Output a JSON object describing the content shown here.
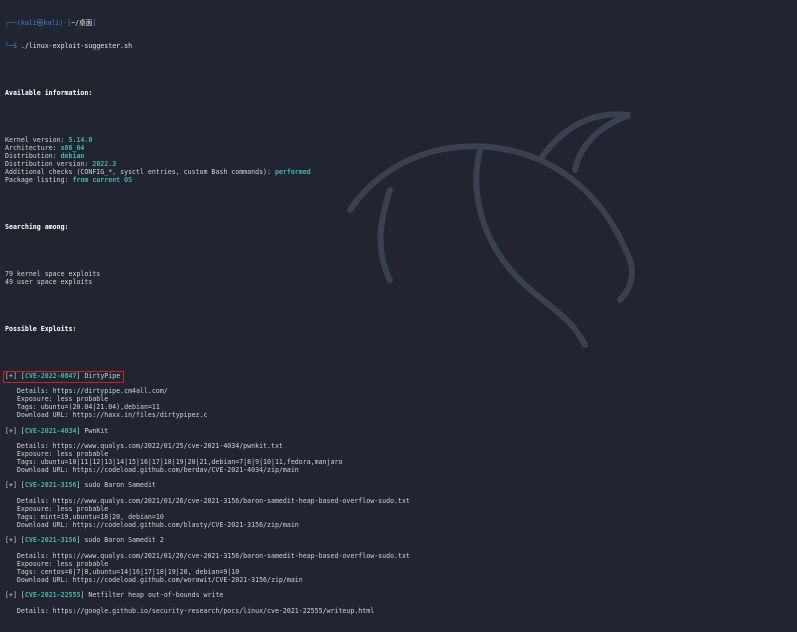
{
  "prompt": {
    "line1_prefix": "┌──(",
    "user": "kali",
    "at": "㉿",
    "host": "kali",
    "line1_mid": ")-[",
    "cwd": "~/桌面",
    "line1_end": "]",
    "line2_prefix": "└─$ ",
    "command": "./linux-exploit-suggester.sh"
  },
  "available": {
    "heading": "Available information:",
    "rows": [
      {
        "label": "Kernel version: ",
        "value": "5.14.0"
      },
      {
        "label": "Architecture: ",
        "value": "x86_64"
      },
      {
        "label": "Distribution: ",
        "value": "debian"
      },
      {
        "label": "Distribution version: ",
        "value": "2022.3"
      },
      {
        "label": "Additional checks (CONFIG_*, sysctl entries, custom Bash commands): ",
        "value": "performed"
      },
      {
        "label": "Package listing: ",
        "value": "from current OS"
      }
    ]
  },
  "searching": {
    "heading": "Searching among:",
    "lines": [
      "79 kernel space exploits",
      "49 user space exploits"
    ]
  },
  "possible": {
    "heading": "Possible Exploits:",
    "exploits": [
      {
        "tag": "[+] ",
        "lb": "[",
        "cve": "CVE-2022-0847",
        "rb": "]",
        "name": " DirtyPipe",
        "details": [
          "   Details: https://dirtypipe.cm4all.com/",
          "   Exposure: less probable",
          "   Tags: ubuntu=(20.04|21.04),debian=11",
          "   Download URL: https://haxx.in/files/dirtypipez.c"
        ]
      },
      {
        "tag": "[+] ",
        "lb": "[",
        "cve": "CVE-2021-4034",
        "rb": "]",
        "name": " PwnKit",
        "details": [
          "   Details: https://www.qualys.com/2022/01/25/cve-2021-4034/pwnkit.txt",
          "   Exposure: less probable",
          "   Tags: ubuntu=10|11|12|13|14|15|16|17|18|19|20|21,debian=7|8|9|10|11,fedora,manjaro",
          "   Download URL: https://codeload.github.com/berdav/CVE-2021-4034/zip/main"
        ]
      },
      {
        "tag": "[+] ",
        "lb": "[",
        "cve": "CVE-2021-3156",
        "rb": "]",
        "name": " sudo Baron Samedit",
        "details": [
          "   Details: https://www.qualys.com/2021/01/26/cve-2021-3156/baron-samedit-heap-based-overflow-sudo.txt",
          "   Exposure: less probable",
          "   Tags: mint=19,ubuntu=18|20, debian=10",
          "   Download URL: https://codeload.github.com/blasty/CVE-2021-3156/zip/main"
        ]
      },
      {
        "tag": "[+] ",
        "lb": "[",
        "cve": "CVE-2021-3156",
        "rb": "]",
        "name": " sudo Baron Samedit 2",
        "details": [
          "   Details: https://www.qualys.com/2021/01/26/cve-2021-3156/baron-samedit-heap-based-overflow-sudo.txt",
          "   Exposure: less probable",
          "   Tags: centos=6|7|8,ubuntu=14|16|17|18|19|20, debian=9|10",
          "   Download URL: https://codeload.github.com/worawit/CVE-2021-3156/zip/main"
        ]
      },
      {
        "tag": "[+] ",
        "lb": "[",
        "cve": "CVE-2021-22555",
        "rb": "]",
        "name": " Netfilter heap out-of-bounds write",
        "details": [
          "   Details: https://google.github.io/security-research/pocs/linux/cve-2021-22555/writeup.html"
        ]
      }
    ]
  },
  "colors": {
    "background": "#20252f",
    "prompt_blue": "#3a86d9",
    "accent_teal": "#3fb8a8",
    "highlight_box": "#d11f1f"
  },
  "icons": {
    "watermark": "kali-dragon-icon"
  }
}
